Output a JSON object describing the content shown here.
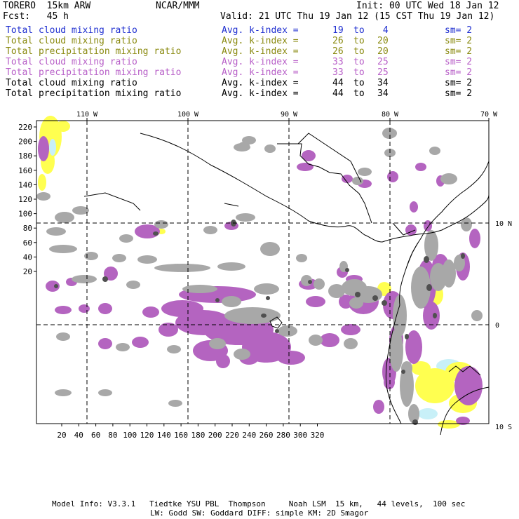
{
  "header": {
    "model": "TORERO  15km ARW",
    "org": "NCAR/MMM",
    "init": "Init: 00 UTC Wed 18 Jan 12",
    "fcst": "Fcst:   45 h",
    "valid": "Valid: 21 UTC Thu 19 Jan 12 (15 CST Thu 19 Jan 12)"
  },
  "legend": [
    {
      "field": "Total cloud mixing ratio",
      "avg": "Avg. k-index =",
      "a": "19",
      "to": "to",
      "b": " 4",
      "sm": "sm= 2",
      "color": "#1f2fd0"
    },
    {
      "field": "Total cloud mixing ratio",
      "avg": "Avg. k-index =",
      "a": "26",
      "to": "to",
      "b": "20",
      "sm": "sm= 2",
      "color": "#8a8a10"
    },
    {
      "field": "Total precipitation mixing ratio",
      "avg": "Avg. k-index =",
      "a": "26",
      "to": "to",
      "b": "20",
      "sm": "sm= 2",
      "color": "#8a8a10"
    },
    {
      "field": "Total cloud mixing ratio",
      "avg": "Avg. k-index =",
      "a": "33",
      "to": "to",
      "b": "25",
      "sm": "sm= 2",
      "color": "#b860c8"
    },
    {
      "field": "Total precipitation mixing ratio",
      "avg": "Avg. k-index =",
      "a": "33",
      "to": "to",
      "b": "25",
      "sm": "sm= 2",
      "color": "#b860c8"
    },
    {
      "field": "Total cloud mixing ratio",
      "avg": "Avg. k-index =",
      "a": "44",
      "to": "to",
      "b": "34",
      "sm": "sm= 2",
      "color": "#000000"
    },
    {
      "field": "Total precipitation mixing ratio",
      "avg": "Avg. k-index =",
      "a": "44",
      "to": "to",
      "b": "34",
      "sm": "sm= 2",
      "color": "#000000"
    }
  ],
  "map": {
    "top_lon_labels": [
      "110 W",
      "100 W",
      "90 W",
      "80 W",
      "70 W"
    ],
    "right_lat_labels": [
      "10 N",
      "0",
      "10 S"
    ],
    "left_grid_labels": [
      "220",
      "200",
      "180",
      "160",
      "140",
      "120",
      "100",
      "80",
      "60",
      "40",
      "20"
    ],
    "bottom_grid_labels": [
      "20",
      "40",
      "60",
      "80",
      "100",
      "120",
      "140",
      "160",
      "180",
      "200",
      "220",
      "240",
      "260",
      "280",
      "300",
      "320"
    ],
    "colors": {
      "gray": "#a8a8a8",
      "dark": "#505050",
      "purple": "#b464c0",
      "yellow": "#ffff50",
      "cyan": "#c8f0f8"
    }
  },
  "footer": {
    "line1": "Model Info: V3.3.1   Tiedtke YSU PBL  Thompson     Noah LSM  15 km,   44 levels,  100 sec",
    "line2": "LW: Godd SW: Goddard DIFF: simple KM: 2D Smagor"
  }
}
